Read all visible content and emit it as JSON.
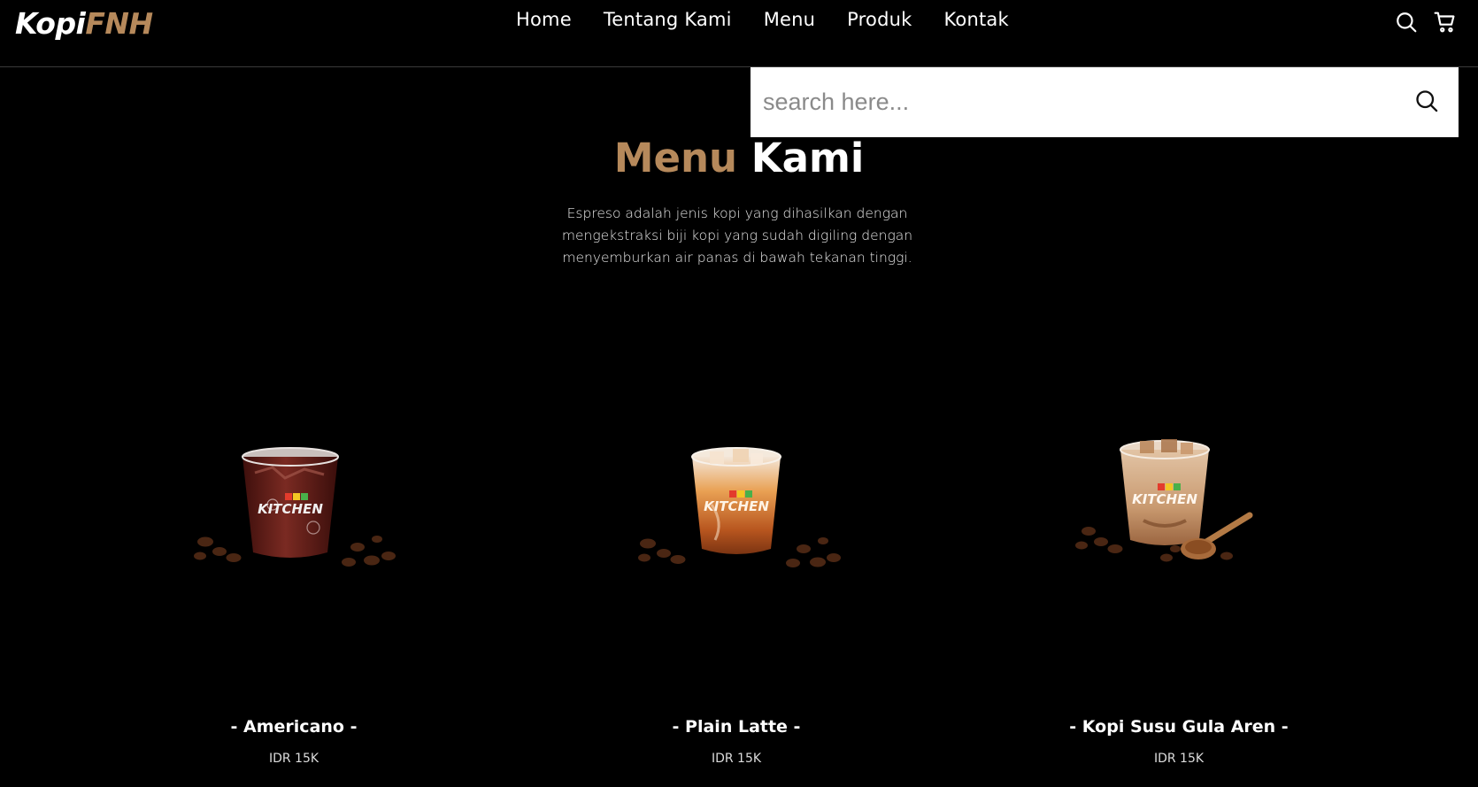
{
  "brand": {
    "part1": "Kopi",
    "part2": "FNH"
  },
  "nav": {
    "items": [
      {
        "label": "Home"
      },
      {
        "label": "Tentang Kami"
      },
      {
        "label": "Menu"
      },
      {
        "label": "Produk"
      },
      {
        "label": "Kontak"
      }
    ],
    "icons": [
      "search-icon",
      "cart-icon"
    ]
  },
  "search": {
    "placeholder": "search here...",
    "value": ""
  },
  "section": {
    "title_part1": "Menu",
    "title_part2": "Kami",
    "description_lines": [
      "Espreso adalah jenis kopi yang dihasilkan dengan",
      "mengekstraksi biji kopi yang sudah digiling dengan",
      "menyemburkan air panas di bawah tekanan tinggi."
    ]
  },
  "products": [
    {
      "name": "- Americano -",
      "price": "IDR 15K",
      "cup_label": "KITCHEN"
    },
    {
      "name": "- Plain Latte -",
      "price": "IDR 15K",
      "cup_label": "KITCHEN"
    },
    {
      "name": "- Kopi Susu Gula Aren -",
      "price": "IDR 15K",
      "cup_label": "KITCHEN"
    }
  ],
  "colors": {
    "accent": "#b6895b",
    "background": "#000000",
    "text": "#ffffff"
  }
}
